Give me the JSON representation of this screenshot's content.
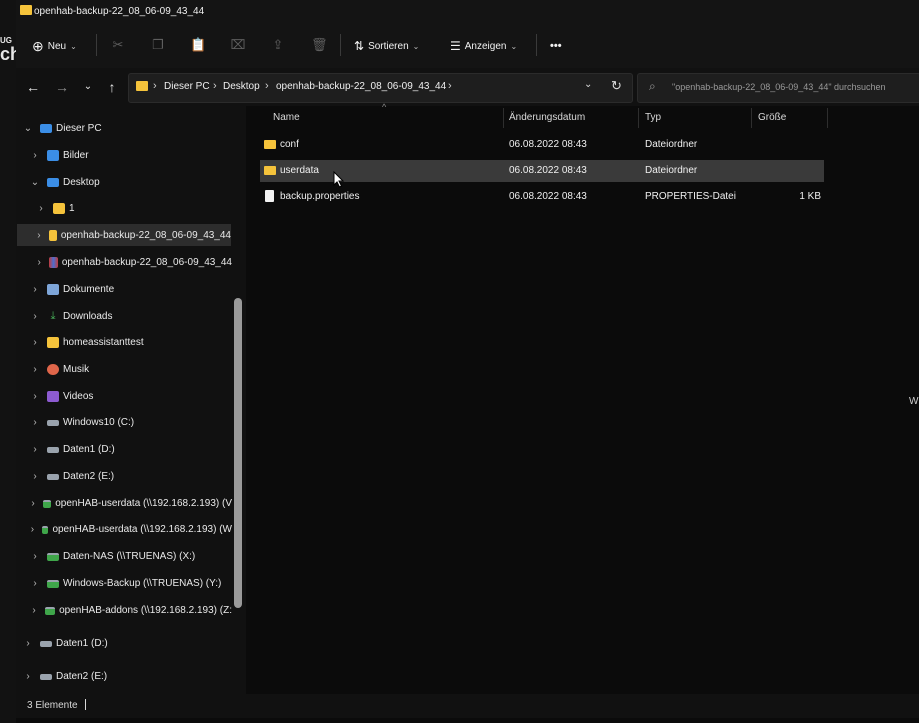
{
  "window": {
    "title": "openhab-backup-22_08_06-09_43_44"
  },
  "edge_fragments": {
    "top": "UG",
    "big": "ch",
    "right": "W"
  },
  "toolbar": {
    "new_label": "Neu",
    "sort_label": "Sortieren",
    "view_label": "Anzeigen",
    "more_label": "•••"
  },
  "address": {
    "crumbs": [
      "Dieser PC",
      "Desktop",
      "openhab-backup-22_08_06-09_43_44"
    ],
    "search_placeholder": "\"openhab-backup-22_08_06-09_43_44\" durchsuchen"
  },
  "nav_tree": [
    {
      "label": "Dieser PC",
      "icon": "pc-icon"
    },
    {
      "label": "Bilder",
      "icon": "pictures-icon"
    },
    {
      "label": "Desktop",
      "icon": "desktop-icon"
    },
    {
      "label": "1",
      "icon": "folder-icon"
    },
    {
      "label": "openhab-backup-22_08_06-09_43_44",
      "icon": "folder-icon"
    },
    {
      "label": "openhab-backup-22_08_06-09_43_44",
      "icon": "archive-icon"
    },
    {
      "label": "Dokumente",
      "icon": "documents-icon"
    },
    {
      "label": "Downloads",
      "icon": "download-icon"
    },
    {
      "label": "homeassistanttest",
      "icon": "folder-icon"
    },
    {
      "label": "Musik",
      "icon": "music-icon"
    },
    {
      "label": "Videos",
      "icon": "videos-icon"
    },
    {
      "label": "Windows10 (C:)",
      "icon": "drive-icon"
    },
    {
      "label": "Daten1 (D:)",
      "icon": "drive-icon"
    },
    {
      "label": "Daten2 (E:)",
      "icon": "drive-icon"
    },
    {
      "label": "openHAB-userdata (\\\\192.168.2.193) (V",
      "icon": "network-drive-icon"
    },
    {
      "label": "openHAB-userdata (\\\\192.168.2.193) (W",
      "icon": "network-drive-icon"
    },
    {
      "label": "Daten-NAS (\\\\TRUENAS) (X:)",
      "icon": "network-drive-icon"
    },
    {
      "label": "Windows-Backup (\\\\TRUENAS) (Y:)",
      "icon": "network-drive-icon"
    },
    {
      "label": "openHAB-addons (\\\\192.168.2.193) (Z:",
      "icon": "network-drive-icon"
    },
    {
      "label": "Daten1 (D:)",
      "icon": "drive-icon"
    },
    {
      "label": "Daten2 (E:)",
      "icon": "drive-icon"
    }
  ],
  "columns": {
    "name": "Name",
    "date": "Änderungsdatum",
    "type": "Typ",
    "size": "Größe"
  },
  "files": [
    {
      "name": "conf",
      "date": "06.08.2022 08:43",
      "type": "Dateiordner",
      "size": ""
    },
    {
      "name": "userdata",
      "date": "06.08.2022 08:43",
      "type": "Dateiordner",
      "size": ""
    },
    {
      "name": "backup.properties",
      "date": "06.08.2022 08:43",
      "type": "PROPERTIES-Datei",
      "size": "1 KB"
    }
  ],
  "status": {
    "count": "3 Elemente"
  }
}
